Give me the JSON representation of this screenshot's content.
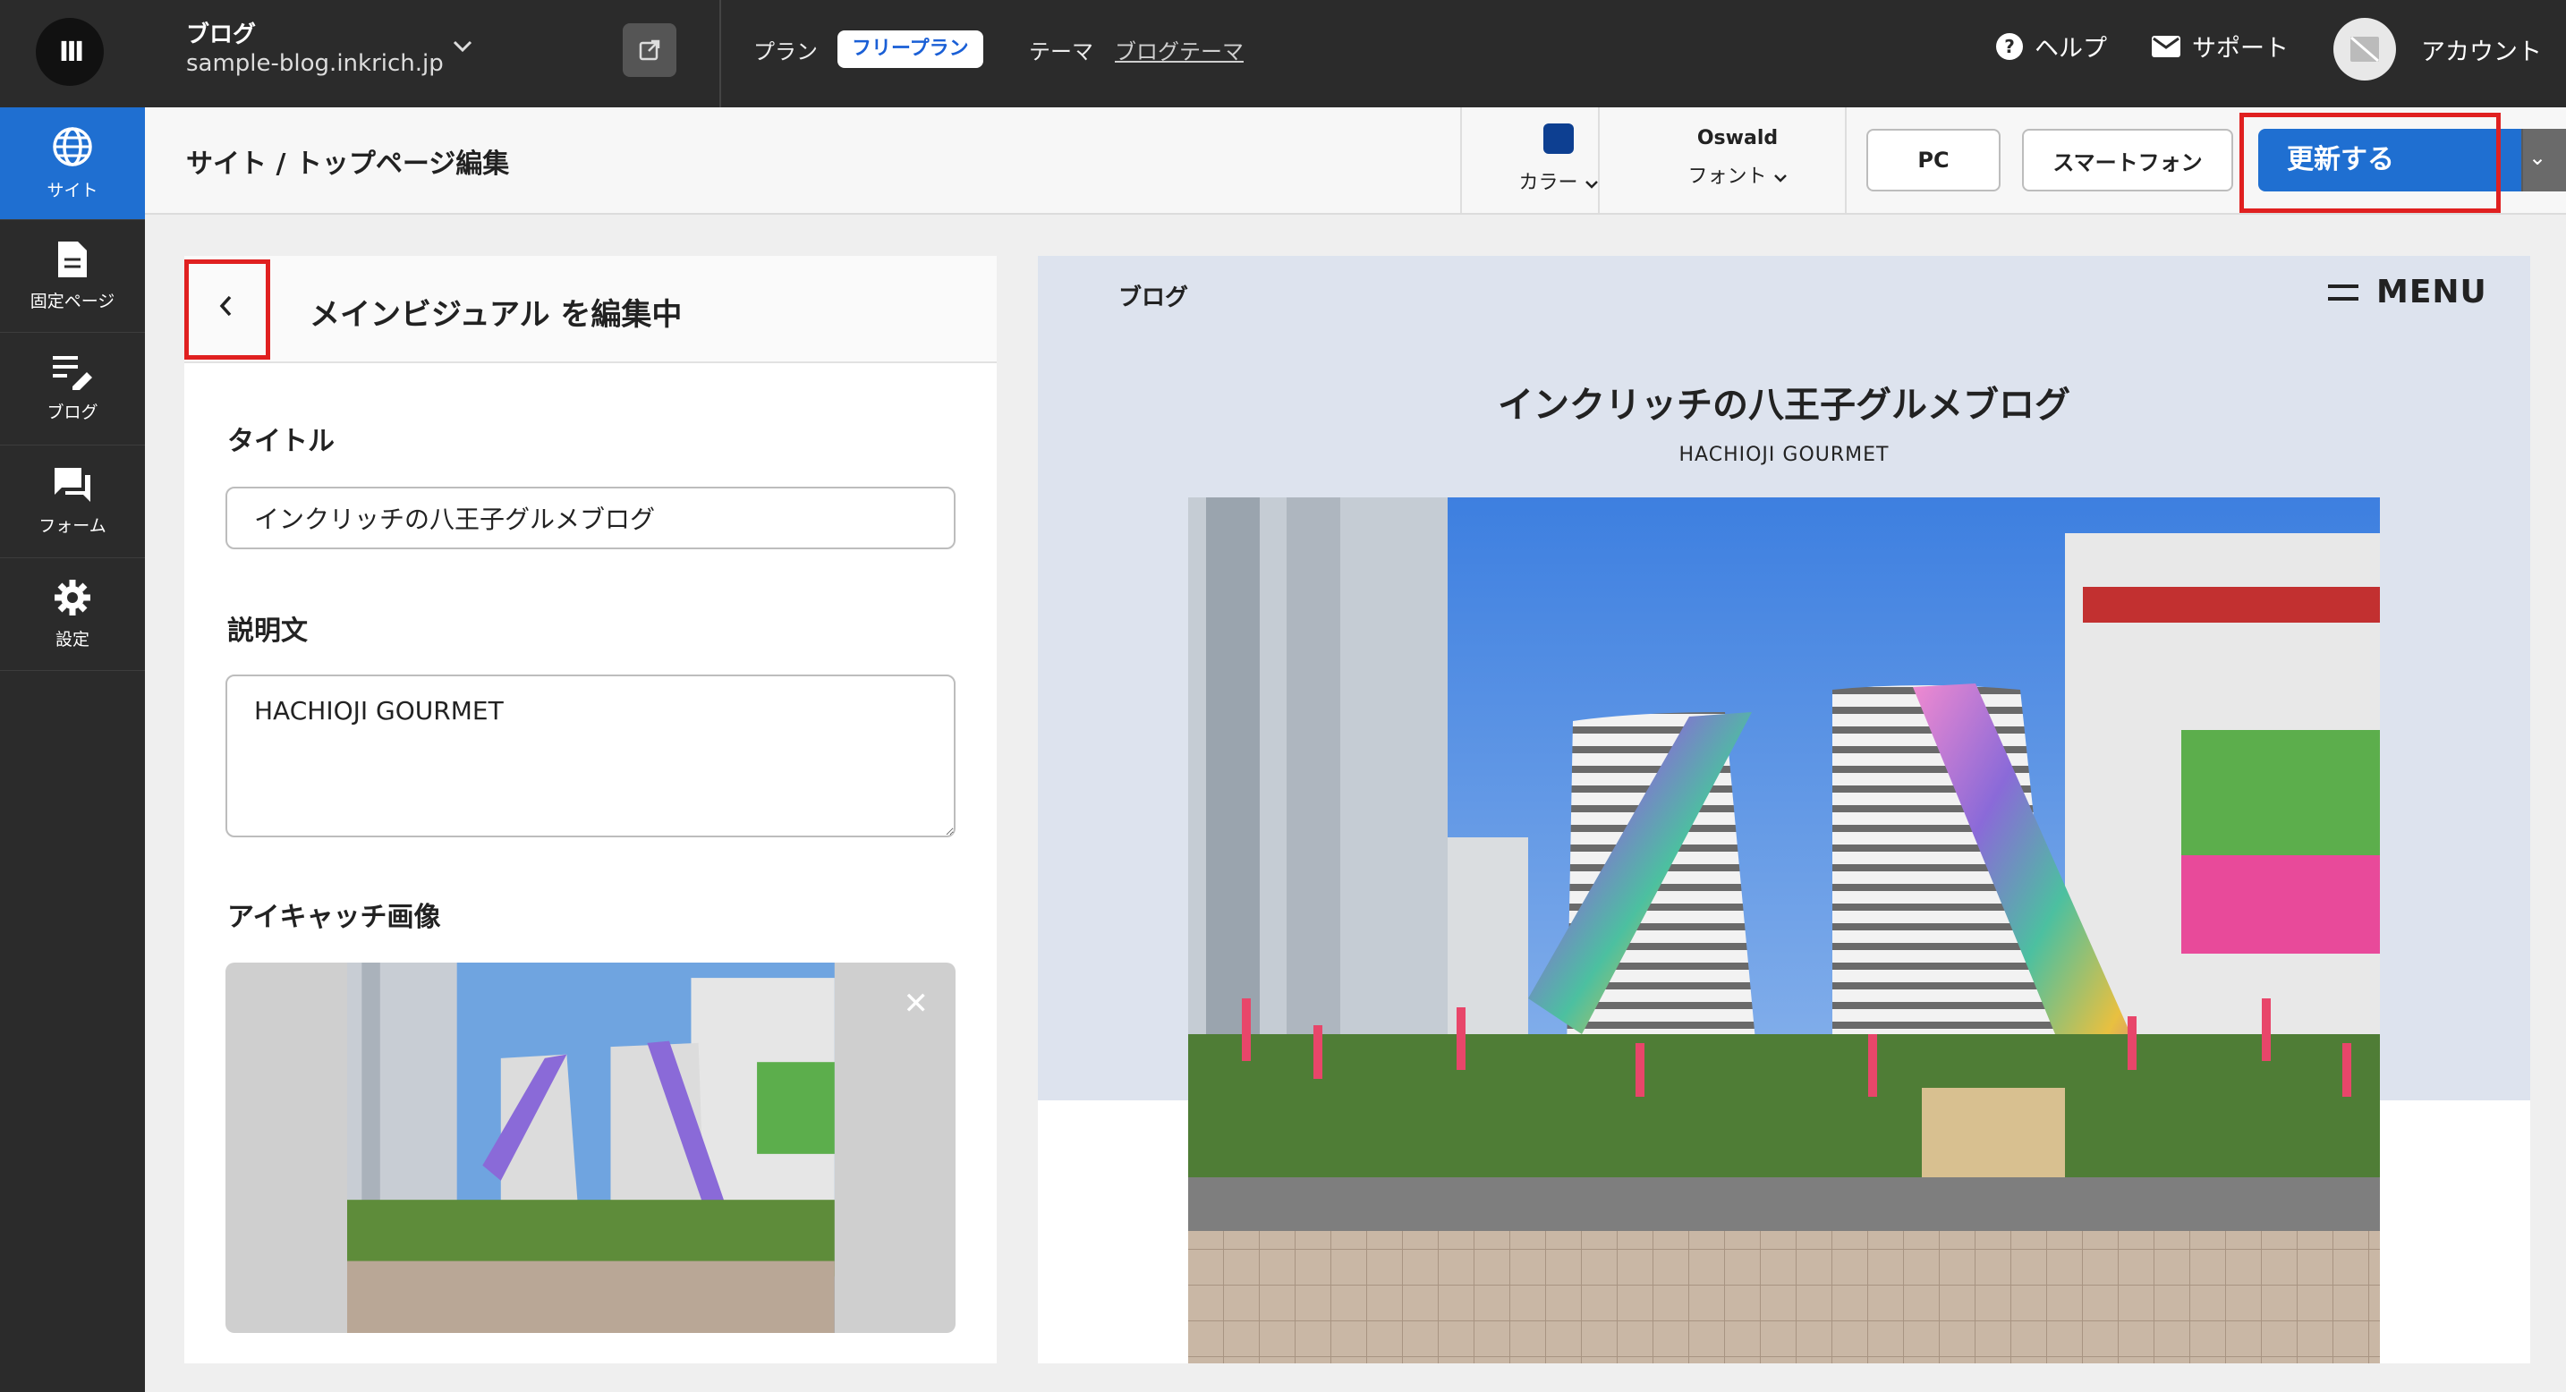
{
  "topbar": {
    "blog_name": "ブログ",
    "blog_url": "sample-blog.inkrich.jp",
    "plan_label": "プラン",
    "plan_badge": "フリープラン",
    "theme_label": "テーマ",
    "theme_link": "ブログテーマ",
    "help": "ヘルプ",
    "support": "サポート",
    "account": "アカウント"
  },
  "sidebar": {
    "items": [
      {
        "label": "サイト",
        "icon": "globe-icon",
        "active": true
      },
      {
        "label": "固定ページ",
        "icon": "document-icon"
      },
      {
        "label": "ブログ",
        "icon": "edit-list-icon"
      },
      {
        "label": "フォーム",
        "icon": "chat-icon"
      },
      {
        "label": "設定",
        "icon": "gear-icon"
      }
    ]
  },
  "toolbar": {
    "breadcrumb": "サイト / トップページ編集",
    "color_label": "カラー",
    "color_value": "#0d3f91",
    "font_name": "Oswald",
    "font_label": "フォント",
    "pc_button": "PC",
    "smartphone_button": "スマートフォン",
    "update_button": "更新する"
  },
  "panel": {
    "title": "メインビジュアル を編集中",
    "title_label": "タイトル",
    "title_value": "インクリッチの八王子グルメブログ",
    "description_label": "説明文",
    "description_value": "HACHIOJI GOURMET",
    "eyecatch_label": "アイキャッチ画像"
  },
  "preview": {
    "brand": "ブログ",
    "menu": "MENU",
    "title": "インクリッチの八王子グルメブログ",
    "subtitle": "HACHIOJI GOURMET"
  },
  "colors": {
    "accent": "#1f6fd1",
    "highlight": "#e02020",
    "dark": "#2b2b2b"
  }
}
